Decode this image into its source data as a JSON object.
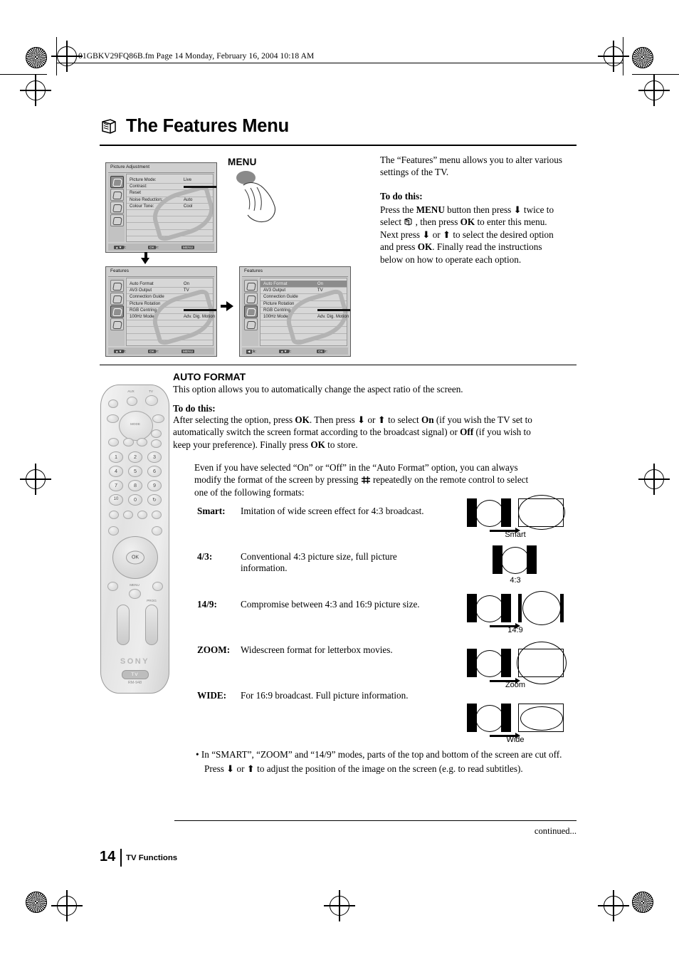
{
  "page_header": {
    "file_line": "01GBKV29FQ86B.fm  Page 14  Monday, February 16, 2004  10:18 AM"
  },
  "title": {
    "text": "The Features Menu",
    "icon": "book-3d-icon"
  },
  "menu_press": {
    "label": "MENU"
  },
  "osd_picture": {
    "title": "Picture  Adjustment",
    "rows": [
      {
        "label": "Picture Mode:",
        "value": "Live"
      },
      {
        "label": "Contrast:",
        "value": "",
        "bar": true
      },
      {
        "label": "Reset",
        "value": ""
      },
      {
        "label": "Noise Reduction:",
        "value": "Auto"
      },
      {
        "label": "Colour Tone:",
        "value": "Cool"
      }
    ],
    "footer": {
      "select": "Select:",
      "enter": "Enter:",
      "enter_key": "OK",
      "exit": "Exit:",
      "exit_key": "MENU"
    }
  },
  "osd_features_1": {
    "title": "Features",
    "rows": [
      {
        "label": "Auto Format",
        "value": "On"
      },
      {
        "label": "AV3 Output",
        "value": "TV"
      },
      {
        "label": "Connection Guide",
        "value": ""
      },
      {
        "label": "Picture Rotation",
        "value": ""
      },
      {
        "label": "RGB Centring",
        "value": "",
        "bar": true
      },
      {
        "label": "100Hz Mode",
        "value": "Adv. Dig. Motion"
      }
    ],
    "footer": {
      "select": "Select:",
      "enter": "Enter:",
      "enter_key": "OK",
      "exit": "Exit:",
      "exit_key": "MENU"
    }
  },
  "osd_features_2": {
    "title": "Features",
    "rows": [
      {
        "label": "Auto Format",
        "value": "On",
        "highlight": true
      },
      {
        "label": "AV3 Output",
        "value": "TV"
      },
      {
        "label": "Connection Guide",
        "value": ""
      },
      {
        "label": "Picture Rotation",
        "value": ""
      },
      {
        "label": "RGB Centring",
        "value": "",
        "bar": true
      },
      {
        "label": "100Hz Mode",
        "value": "Adv. Dig. Motion"
      }
    ],
    "footer": {
      "back": "Back:",
      "select": "Select:",
      "enter": "Enter:",
      "enter_key": "OK"
    }
  },
  "intro": {
    "paragraph": "The “Features” menu allows you to alter various settings of the TV.",
    "todo_heading": "To do this:",
    "todo_line1_a": "Press the ",
    "todo_menu": "MENU",
    "todo_line1_b": " button then press ",
    "todo_line1_c": " twice to",
    "todo_line2_a": "select ",
    "todo_line2_b": " , then press ",
    "todo_ok1": "OK",
    "todo_line2_c": " to enter this menu.",
    "todo_line3_a": "Next press ",
    "todo_line3_b": " or ",
    "todo_line3_c": " to select the desired option",
    "todo_line4_a": "and press ",
    "todo_ok2": "OK",
    "todo_line4_b": ". Finally read the instructions",
    "todo_line5": "below on how to operate each option."
  },
  "auto_format": {
    "heading": "AUTO FORMAT",
    "description": "This option allows you to automatically change the aspect ratio of the screen.",
    "todo_heading": "To do this:",
    "line1_a": "After selecting the option, press ",
    "ok1": "OK",
    "line1_b": ". Then press ",
    "line1_c": " or ",
    "line1_d": " to select ",
    "on": "On",
    "line1_e": " (if you wish the TV set to",
    "line2_a": "automatically switch the screen format according to the broadcast signal) or ",
    "off": "Off",
    "line2_b": " (if you wish to",
    "line3_a": "keep your preference). Finally press ",
    "ok2": "OK",
    "line3_b": " to store."
  },
  "note": {
    "line1": "Even if you have selected “On” or “Off” in the “Auto Format” option, you can always",
    "line2_a": "modify the format of the screen by pressing ",
    "line2_b": " repeatedly on the remote control to select",
    "line3": "one of the following formats:"
  },
  "formats": [
    {
      "term": "Smart:",
      "desc": "Imitation of wide screen effect for 4:3 broadcast.",
      "diagram_label": "Smart"
    },
    {
      "term": "4/3:",
      "desc": "Conventional 4:3 picture size, full picture information.",
      "diagram_label": "4:3"
    },
    {
      "term": "14/9:",
      "desc": "Compromise between 4:3 and 16:9 picture size.",
      "diagram_label": "14:9"
    },
    {
      "term": "ZOOM:",
      "desc": "Widescreen format for letterbox movies.",
      "diagram_label": "Zoom"
    },
    {
      "term": "WIDE:",
      "desc": "For 16:9 broadcast. Full picture information.",
      "diagram_label": "Wide"
    }
  ],
  "bullet_note": {
    "line1": "• In “SMART”, “ZOOM” and “14/9” modes, parts of the top and bottom of the screen are cut off.",
    "line2_a": "Press ",
    "line2_b": " or ",
    "line2_c": " to adjust the position of the image on the screen (e.g. to read subtitles)."
  },
  "remote": {
    "brand": "SONY",
    "tv_chip": "TV",
    "model": "RM-948",
    "menu_label": "MENU",
    "prog_label": "PROG",
    "ok_label": "OK",
    "mode_label": "MODE",
    "aux_label": "AUX",
    "tv_label": "TV",
    "numbers": [
      "1",
      "2",
      "3",
      "4",
      "5",
      "6",
      "7",
      "8",
      "9",
      "10",
      "0"
    ]
  },
  "footer": {
    "continued": "continued...",
    "page_number": "14",
    "section": "TV Functions"
  }
}
